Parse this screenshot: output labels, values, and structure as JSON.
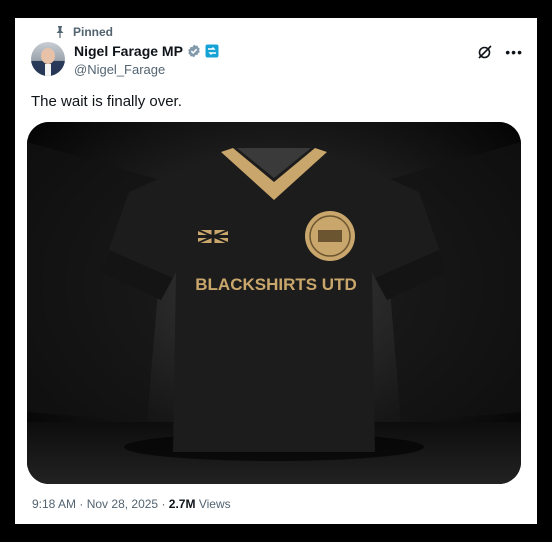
{
  "tweet": {
    "pinned_label": "Pinned",
    "author_name": "Nigel Farage MP",
    "author_handle": "@Nigel_Farage",
    "text": "The wait is finally over.",
    "image": {
      "jersey_text": "BLACKSHIRTS UTD"
    },
    "time": "9:18 AM",
    "separator": "·",
    "date": "Nov 28, 2025",
    "views_count": "2.7M",
    "views_label": "Views"
  },
  "icons": {
    "pin": "pin-icon",
    "verified": "verified-badge-icon",
    "affiliate": "affiliate-badge-icon",
    "grok": "grok-icon",
    "more": "more-icon"
  },
  "colors": {
    "text_primary": "#0f1419",
    "text_secondary": "#536471",
    "jersey_gold": "#c9a66b",
    "jersey_black": "#1b1b1b"
  }
}
